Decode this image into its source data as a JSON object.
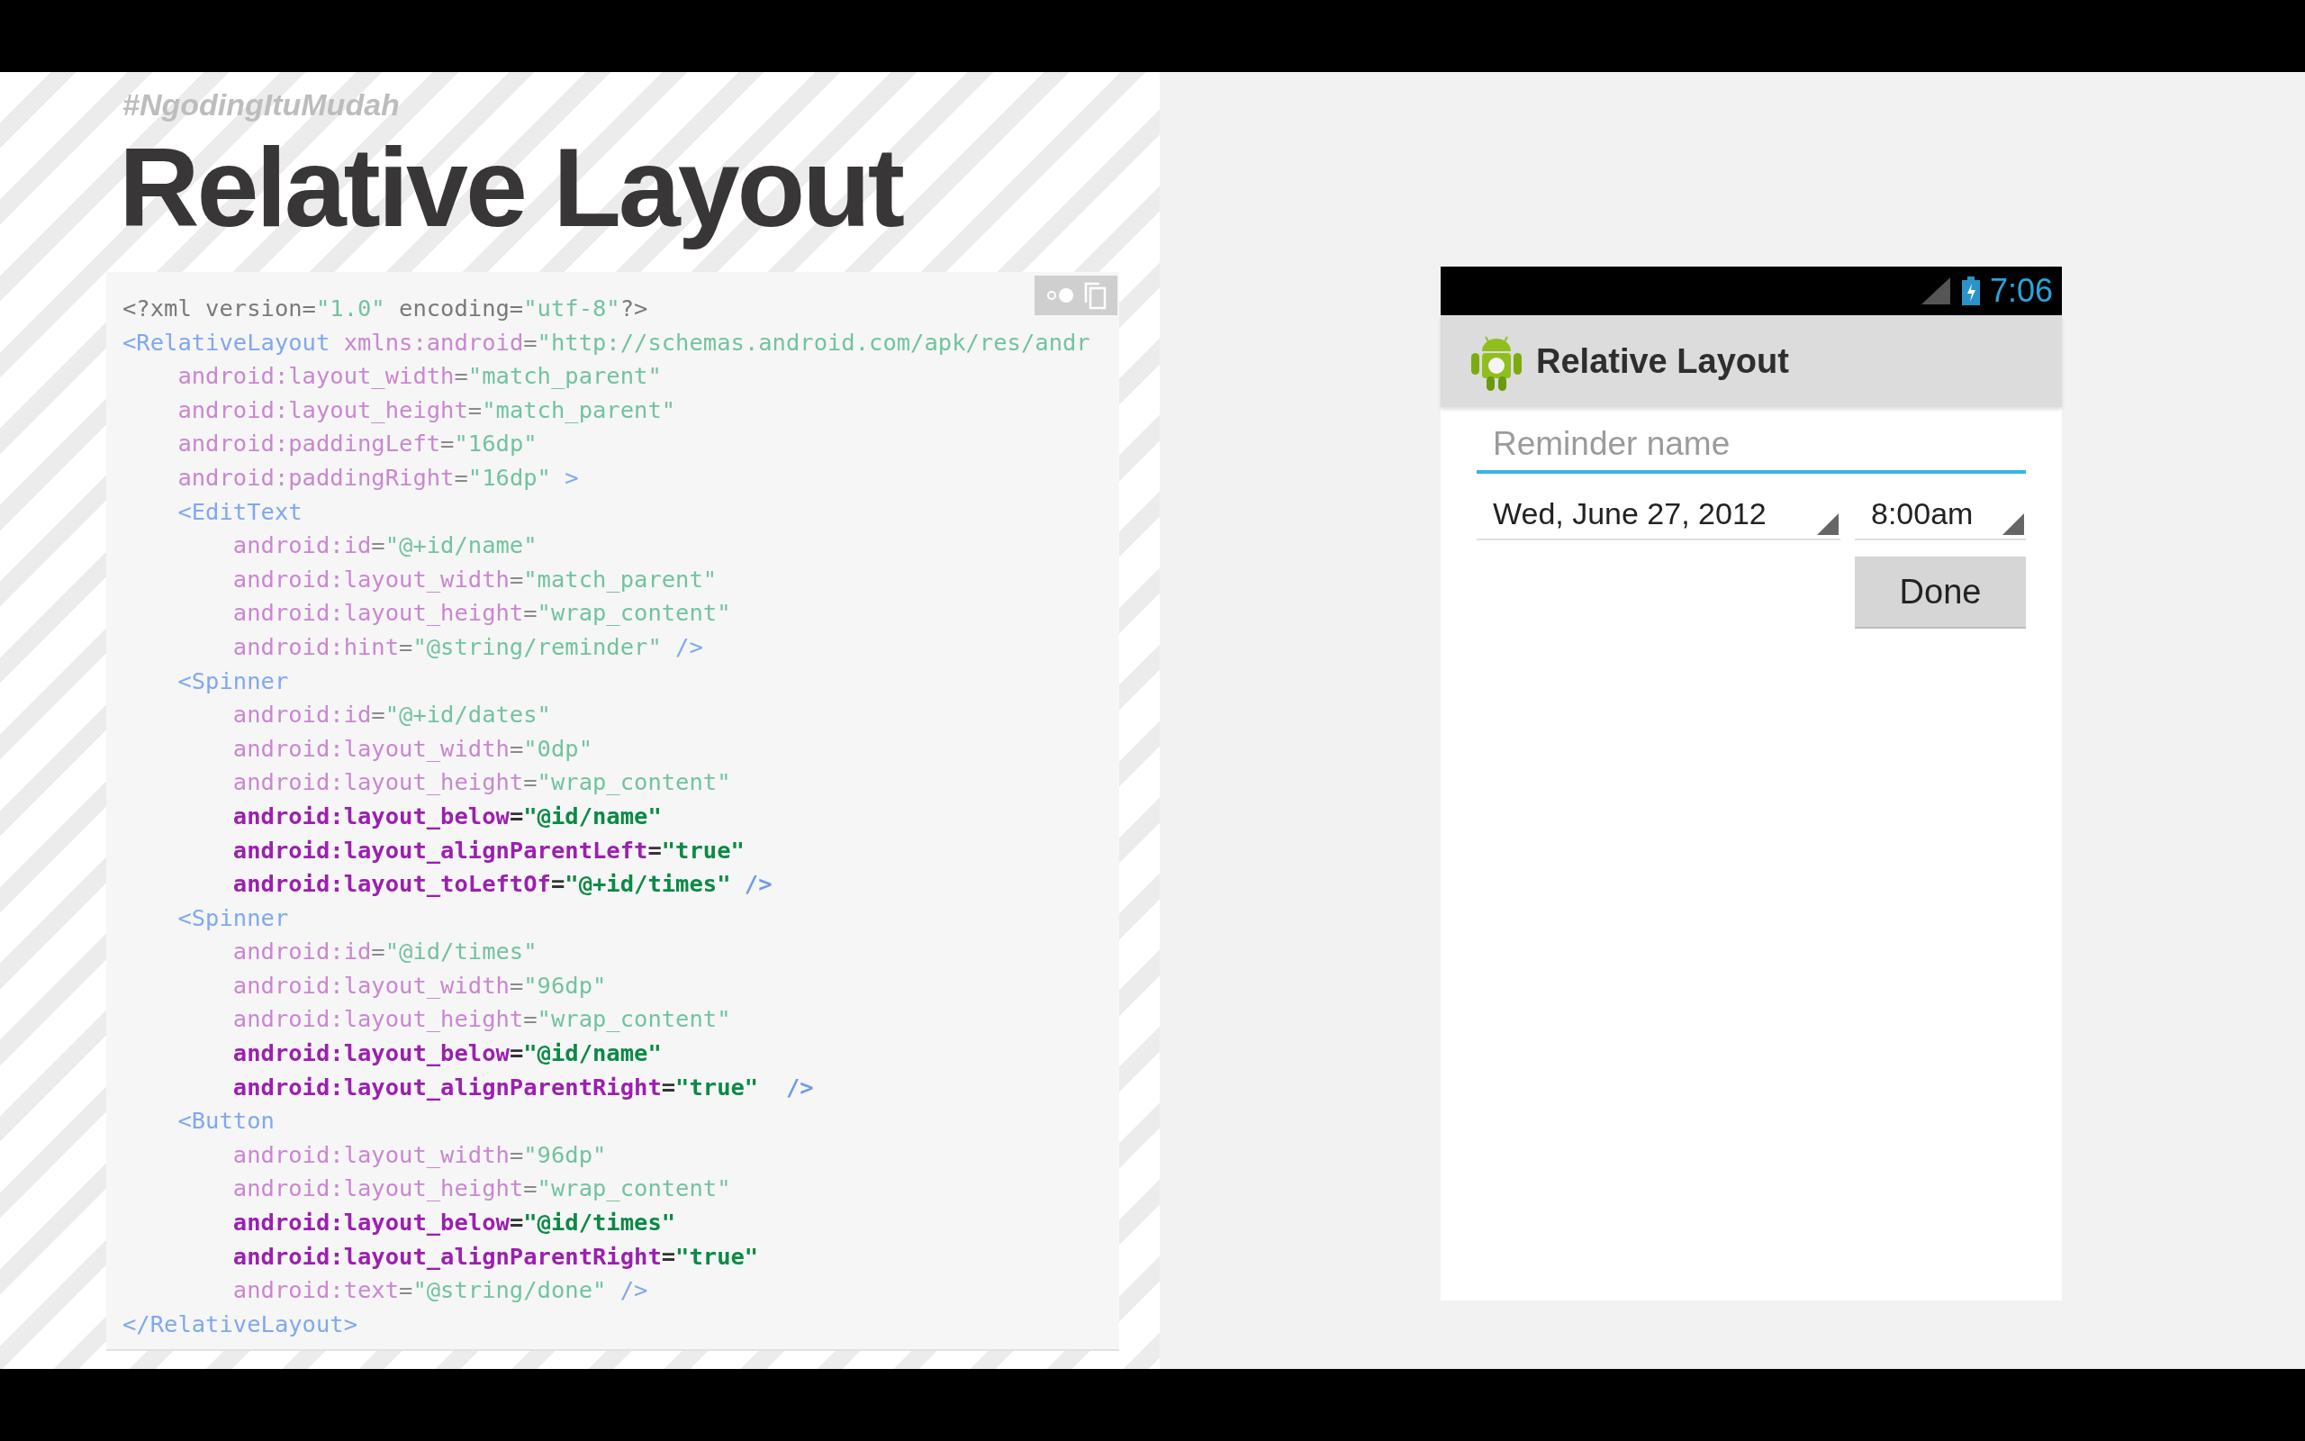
{
  "slide": {
    "hashtag": "#NgodingItuMudah",
    "title": "Relative Layout"
  },
  "code_block": {
    "lines": [
      {
        "bold": false,
        "tokens": [
          {
            "kind": "plain",
            "text": "<?xml version="
          },
          {
            "kind": "value",
            "text": "\"1.0\""
          },
          {
            "kind": "plain",
            "text": " encoding="
          },
          {
            "kind": "value",
            "text": "\"utf-8\""
          },
          {
            "kind": "plain",
            "text": "?>"
          }
        ]
      },
      {
        "bold": false,
        "tokens": [
          {
            "kind": "tag",
            "text": "<RelativeLayout"
          },
          {
            "kind": "attr",
            "text": " xmlns:android"
          },
          {
            "kind": "eq",
            "text": "="
          },
          {
            "kind": "value",
            "text": "\"http://schemas.android.com/apk/res/andr"
          }
        ]
      },
      {
        "bold": false,
        "tokens": [
          {
            "kind": "attr",
            "text": "    android:layout_width"
          },
          {
            "kind": "eq",
            "text": "="
          },
          {
            "kind": "value",
            "text": "\"match_parent\""
          }
        ]
      },
      {
        "bold": false,
        "tokens": [
          {
            "kind": "attr",
            "text": "    android:layout_height"
          },
          {
            "kind": "eq",
            "text": "="
          },
          {
            "kind": "value",
            "text": "\"match_parent\""
          }
        ]
      },
      {
        "bold": false,
        "tokens": [
          {
            "kind": "attr",
            "text": "    android:paddingLeft"
          },
          {
            "kind": "eq",
            "text": "="
          },
          {
            "kind": "value",
            "text": "\"16dp\""
          }
        ]
      },
      {
        "bold": false,
        "tokens": [
          {
            "kind": "attr",
            "text": "    android:paddingRight"
          },
          {
            "kind": "eq",
            "text": "="
          },
          {
            "kind": "value",
            "text": "\"16dp\""
          },
          {
            "kind": "tag",
            "text": " >"
          }
        ]
      },
      {
        "bold": false,
        "tokens": [
          {
            "kind": "tag",
            "text": "    <EditText"
          }
        ]
      },
      {
        "bold": false,
        "tokens": [
          {
            "kind": "attr",
            "text": "        android:id"
          },
          {
            "kind": "eq",
            "text": "="
          },
          {
            "kind": "value",
            "text": "\"@+id/name\""
          }
        ]
      },
      {
        "bold": false,
        "tokens": [
          {
            "kind": "attr",
            "text": "        android:layout_width"
          },
          {
            "kind": "eq",
            "text": "="
          },
          {
            "kind": "value",
            "text": "\"match_parent\""
          }
        ]
      },
      {
        "bold": false,
        "tokens": [
          {
            "kind": "attr",
            "text": "        android:layout_height"
          },
          {
            "kind": "eq",
            "text": "="
          },
          {
            "kind": "value",
            "text": "\"wrap_content\""
          }
        ]
      },
      {
        "bold": false,
        "tokens": [
          {
            "kind": "attr",
            "text": "        android:hint"
          },
          {
            "kind": "eq",
            "text": "="
          },
          {
            "kind": "value",
            "text": "\"@string/reminder\""
          },
          {
            "kind": "tag",
            "text": " />"
          }
        ]
      },
      {
        "bold": false,
        "tokens": [
          {
            "kind": "tag",
            "text": "    <Spinner"
          }
        ]
      },
      {
        "bold": false,
        "tokens": [
          {
            "kind": "attr",
            "text": "        android:id"
          },
          {
            "kind": "eq",
            "text": "="
          },
          {
            "kind": "value",
            "text": "\"@+id/dates\""
          }
        ]
      },
      {
        "bold": false,
        "tokens": [
          {
            "kind": "attr",
            "text": "        android:layout_width"
          },
          {
            "kind": "eq",
            "text": "="
          },
          {
            "kind": "value",
            "text": "\"0dp\""
          }
        ]
      },
      {
        "bold": false,
        "tokens": [
          {
            "kind": "attr",
            "text": "        android:layout_height"
          },
          {
            "kind": "eq",
            "text": "="
          },
          {
            "kind": "value",
            "text": "\"wrap_content\""
          }
        ]
      },
      {
        "bold": true,
        "tokens": [
          {
            "kind": "attr",
            "text": "        android:layout_below"
          },
          {
            "kind": "eq",
            "text": "="
          },
          {
            "kind": "value",
            "text": "\"@id/name\""
          }
        ]
      },
      {
        "bold": true,
        "tokens": [
          {
            "kind": "attr",
            "text": "        android:layout_alignParentLeft"
          },
          {
            "kind": "eq",
            "text": "="
          },
          {
            "kind": "value",
            "text": "\"true\""
          }
        ]
      },
      {
        "bold": true,
        "tokens": [
          {
            "kind": "attr",
            "text": "        android:layout_toLeftOf"
          },
          {
            "kind": "eq",
            "text": "="
          },
          {
            "kind": "value",
            "text": "\"@+id/times\""
          },
          {
            "kind": "tag",
            "text": " />"
          }
        ]
      },
      {
        "bold": false,
        "tokens": [
          {
            "kind": "tag",
            "text": "    <Spinner"
          }
        ]
      },
      {
        "bold": false,
        "tokens": [
          {
            "kind": "attr",
            "text": "        android:id"
          },
          {
            "kind": "eq",
            "text": "="
          },
          {
            "kind": "value",
            "text": "\"@id/times\""
          }
        ]
      },
      {
        "bold": false,
        "tokens": [
          {
            "kind": "attr",
            "text": "        android:layout_width"
          },
          {
            "kind": "eq",
            "text": "="
          },
          {
            "kind": "value",
            "text": "\"96dp\""
          }
        ]
      },
      {
        "bold": false,
        "tokens": [
          {
            "kind": "attr",
            "text": "        android:layout_height"
          },
          {
            "kind": "eq",
            "text": "="
          },
          {
            "kind": "value",
            "text": "\"wrap_content\""
          }
        ]
      },
      {
        "bold": true,
        "tokens": [
          {
            "kind": "attr",
            "text": "        android:layout_below"
          },
          {
            "kind": "eq",
            "text": "="
          },
          {
            "kind": "value",
            "text": "\"@id/name\""
          }
        ]
      },
      {
        "bold": true,
        "tokens": [
          {
            "kind": "attr",
            "text": "        android:layout_alignParentRight"
          },
          {
            "kind": "eq",
            "text": "="
          },
          {
            "kind": "value",
            "text": "\"true\""
          },
          {
            "kind": "tag",
            "text": "  />"
          }
        ]
      },
      {
        "bold": false,
        "tokens": [
          {
            "kind": "tag",
            "text": "    <Button"
          }
        ]
      },
      {
        "bold": false,
        "tokens": [
          {
            "kind": "attr",
            "text": "        android:layout_width"
          },
          {
            "kind": "eq",
            "text": "="
          },
          {
            "kind": "value",
            "text": "\"96dp\""
          }
        ]
      },
      {
        "bold": false,
        "tokens": [
          {
            "kind": "attr",
            "text": "        android:layout_height"
          },
          {
            "kind": "eq",
            "text": "="
          },
          {
            "kind": "value",
            "text": "\"wrap_content\""
          }
        ]
      },
      {
        "bold": true,
        "tokens": [
          {
            "kind": "attr",
            "text": "        android:layout_below"
          },
          {
            "kind": "eq",
            "text": "="
          },
          {
            "kind": "value",
            "text": "\"@id/times\""
          }
        ]
      },
      {
        "bold": true,
        "tokens": [
          {
            "kind": "attr",
            "text": "        android:layout_alignParentRight"
          },
          {
            "kind": "eq",
            "text": "="
          },
          {
            "kind": "value",
            "text": "\"true\""
          }
        ]
      },
      {
        "bold": false,
        "tokens": [
          {
            "kind": "attr",
            "text": "        android:text"
          },
          {
            "kind": "eq",
            "text": "="
          },
          {
            "kind": "value",
            "text": "\"@string/done\""
          },
          {
            "kind": "tag",
            "text": " />"
          }
        ]
      },
      {
        "bold": false,
        "tokens": [
          {
            "kind": "tag",
            "text": "</RelativeLayout>"
          }
        ]
      }
    ]
  },
  "phone": {
    "status_time": "7:06",
    "app_title": "Relative Layout",
    "name_field": {
      "placeholder": "Reminder name"
    },
    "spinners": [
      {
        "value": "Wed, June 27, 2012"
      },
      {
        "value": "8:00am"
      }
    ],
    "button": "Done"
  }
}
